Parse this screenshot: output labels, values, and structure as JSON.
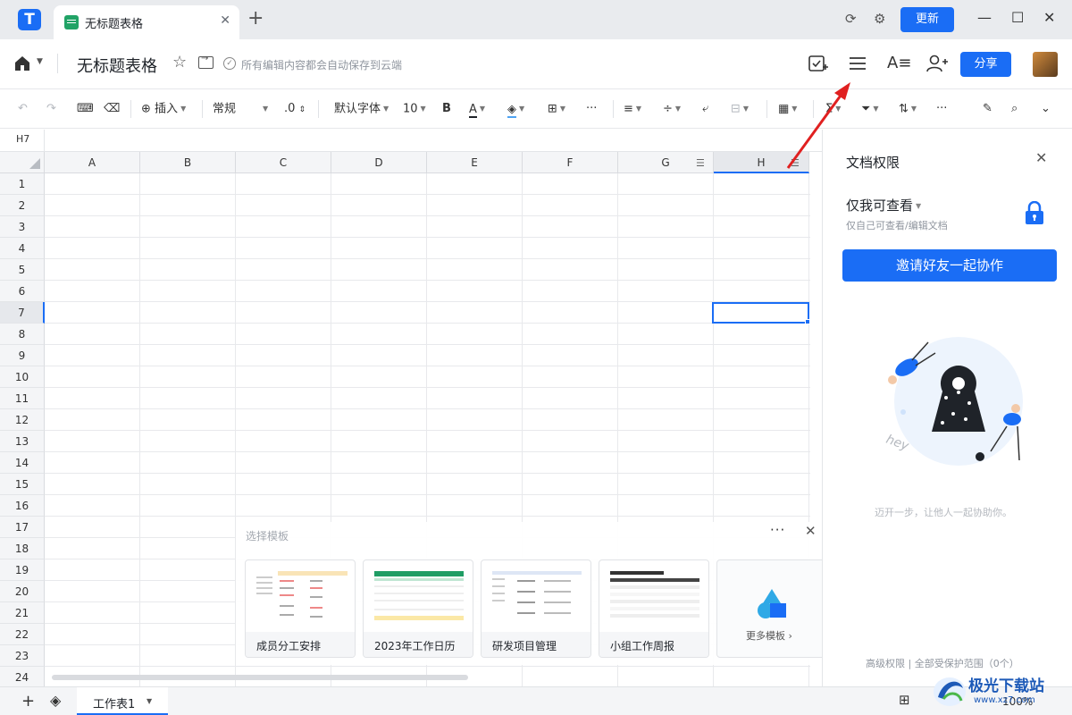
{
  "titlebar": {
    "tab_title": "无标题表格",
    "update_label": "更新",
    "icons": [
      "app-logo",
      "refresh-icon",
      "settings-icon",
      "minimize-icon",
      "maximize-icon",
      "close-icon"
    ]
  },
  "docbar": {
    "title": "无标题表格",
    "save_status": "所有编辑内容都会自动保存到云端",
    "share_label": "分享",
    "icons": [
      "home-icon",
      "star-icon",
      "move-icon",
      "check-icon",
      "checklist-icon",
      "menu-icon",
      "text-format-icon",
      "add-user-icon"
    ]
  },
  "toolbar": {
    "insert_label": "插入",
    "format_label": "常规",
    "decimal_label": ".0",
    "font_label": "默认字体",
    "font_size": "10",
    "bold_label": "B",
    "font_color_label": "A",
    "font_color": "#1f2329",
    "fill_color": "#4ea3f2"
  },
  "formula_bar": {
    "cell_ref": "H7"
  },
  "grid": {
    "columns": [
      "A",
      "B",
      "C",
      "D",
      "E",
      "F",
      "G",
      "H"
    ],
    "rows": [
      "1",
      "2",
      "3",
      "4",
      "5",
      "6",
      "7",
      "8",
      "9",
      "10",
      "11",
      "12",
      "13",
      "14",
      "15",
      "16",
      "17",
      "18",
      "19",
      "20",
      "21",
      "22",
      "23",
      "24"
    ],
    "selected_cell": "H7"
  },
  "templates": {
    "label": "选择模板",
    "items": [
      {
        "name": "成员分工安排"
      },
      {
        "name": "2023年工作日历"
      },
      {
        "name": "研发项目管理"
      },
      {
        "name": "小组工作周报"
      }
    ],
    "more_label": "更多模板",
    "more_icon": "shapes-icon"
  },
  "side_panel": {
    "title": "文档权限",
    "permission": "仅我可查看",
    "permission_desc": "仅自己可查看/编辑文档",
    "invite_label": "邀请好友一起协作",
    "hint": "迈开一步，让他人一起协助你。",
    "footer": "高级权限 | 全部受保护范围（0个）"
  },
  "bottom": {
    "sheet_name": "工作表1",
    "zoom": "100%"
  },
  "watermark": {
    "brand": "极光下载站",
    "url": "www.xz7.com"
  },
  "colors": {
    "accent": "#1a6df5",
    "annotation": "#e02020",
    "sheet_icon": "#21a366"
  }
}
